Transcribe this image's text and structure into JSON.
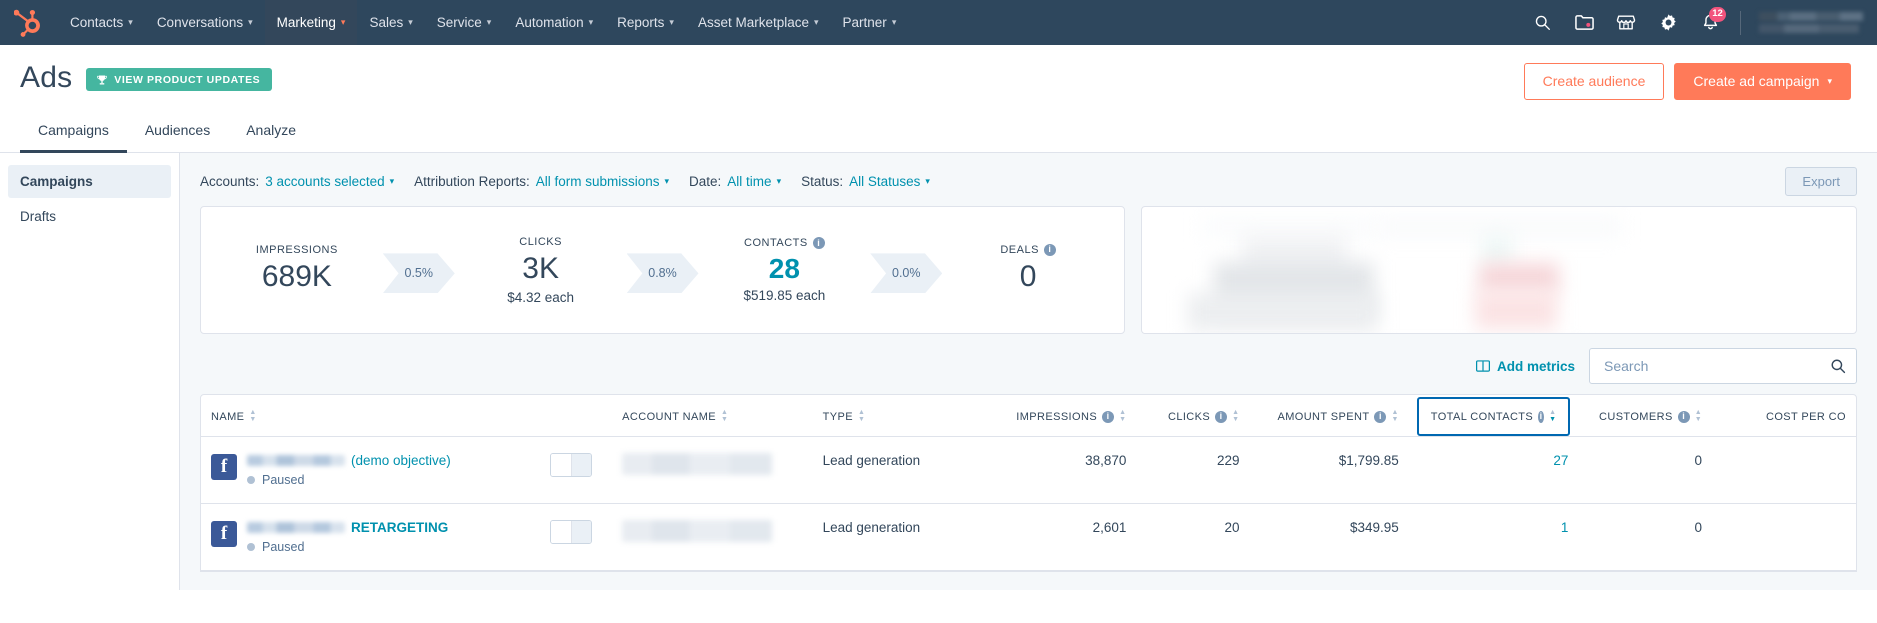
{
  "topnav": {
    "logo_icon": "hubspot-sprocket-logo",
    "items": [
      {
        "label": "Contacts",
        "caret": "▾",
        "active": false
      },
      {
        "label": "Conversations",
        "caret": "▾",
        "active": false
      },
      {
        "label": "Marketing",
        "caret": "▾",
        "active": true
      },
      {
        "label": "Sales",
        "caret": "▾",
        "active": false
      },
      {
        "label": "Service",
        "caret": "▾",
        "active": false
      },
      {
        "label": "Automation",
        "caret": "▾",
        "active": false
      },
      {
        "label": "Reports",
        "caret": "▾",
        "active": false
      },
      {
        "label": "Asset Marketplace",
        "caret": "▾",
        "active": false
      },
      {
        "label": "Partner",
        "caret": "▾",
        "active": false
      }
    ],
    "icons": [
      "search-icon",
      "folder-icon",
      "marketplace-store-icon",
      "gear-icon",
      "notifications-bell-icon"
    ],
    "notification_count": "12"
  },
  "header": {
    "title": "Ads",
    "updates_badge": "VIEW PRODUCT UPDATES",
    "updates_badge_icon": "trophy-icon",
    "create_audience_label": "Create audience",
    "create_campaign_label": "Create ad campaign",
    "create_campaign_caret": "▾"
  },
  "tabs": [
    {
      "label": "Campaigns",
      "active": true
    },
    {
      "label": "Audiences",
      "active": false
    },
    {
      "label": "Analyze",
      "active": false
    }
  ],
  "sidebar": {
    "items": [
      {
        "label": "Campaigns",
        "active": true
      },
      {
        "label": "Drafts",
        "active": false
      }
    ]
  },
  "filters": {
    "groups": [
      {
        "label": "Accounts:",
        "value": "3 accounts selected",
        "caret": "▾"
      },
      {
        "label": "Attribution Reports:",
        "value": "All form submissions",
        "caret": "▾"
      },
      {
        "label": "Date:",
        "value": "All time",
        "caret": "▾"
      },
      {
        "label": "Status:",
        "value": "All Statuses",
        "caret": "▾"
      }
    ],
    "export_label": "Export"
  },
  "funnel": {
    "metrics": [
      {
        "label": "IMPRESSIONS",
        "value": "689K",
        "sub": "",
        "info": false,
        "highlight": false
      },
      {
        "label": "CLICKS",
        "value": "3K",
        "sub": "$4.32 each",
        "info": false,
        "highlight": false
      },
      {
        "label": "CONTACTS",
        "value": "28",
        "sub": "$519.85 each",
        "info": true,
        "highlight": true
      },
      {
        "label": "DEALS",
        "value": "0",
        "sub": "",
        "info": true,
        "highlight": false
      }
    ],
    "rates": [
      "0.5%",
      "0.8%",
      "0.0%"
    ]
  },
  "table_toolbar": {
    "add_metrics_label": "Add metrics",
    "add_metrics_icon": "columns-icon",
    "search_placeholder": "Search",
    "search_value": "",
    "search_icon": "search-icon"
  },
  "table": {
    "columns": [
      {
        "label": "NAME",
        "info": false,
        "align": "left",
        "sorted": false
      },
      {
        "label": "",
        "info": false,
        "align": "left",
        "sorted": false
      },
      {
        "label": "ACCOUNT NAME",
        "info": false,
        "align": "left",
        "sorted": false
      },
      {
        "label": "TYPE",
        "info": false,
        "align": "left",
        "sorted": false
      },
      {
        "label": "IMPRESSIONS",
        "info": true,
        "align": "right",
        "sorted": false
      },
      {
        "label": "CLICKS",
        "info": true,
        "align": "right",
        "sorted": false
      },
      {
        "label": "AMOUNT SPENT",
        "info": true,
        "align": "right",
        "sorted": false
      },
      {
        "label": "TOTAL CONTACTS",
        "info": true,
        "align": "right",
        "sorted": true
      },
      {
        "label": "CUSTOMERS",
        "info": true,
        "align": "right",
        "sorted": false
      },
      {
        "label": "COST PER CO",
        "info": false,
        "align": "right",
        "sorted": false
      }
    ],
    "rows": [
      {
        "platform_icon": "facebook-icon",
        "name_suffix": "(demo objective)",
        "name_bold": false,
        "status": "Paused",
        "type": "Lead generation",
        "impressions": "38,870",
        "clicks": "229",
        "amount_spent": "$1,799.85",
        "total_contacts": "27",
        "customers": "0"
      },
      {
        "platform_icon": "facebook-icon",
        "name_suffix": "RETARGETING",
        "name_bold": true,
        "status": "Paused",
        "type": "Lead generation",
        "impressions": "2,601",
        "clicks": "20",
        "amount_spent": "$349.95",
        "total_contacts": "1",
        "customers": "0"
      }
    ]
  },
  "colors": {
    "nav_bg": "#2e475d",
    "accent_orange": "#ff7a59",
    "link_teal": "#0091ae",
    "badge_green": "#45b6a0",
    "badge_pink": "#f2547d",
    "page_bg": "#f5f8fa"
  }
}
